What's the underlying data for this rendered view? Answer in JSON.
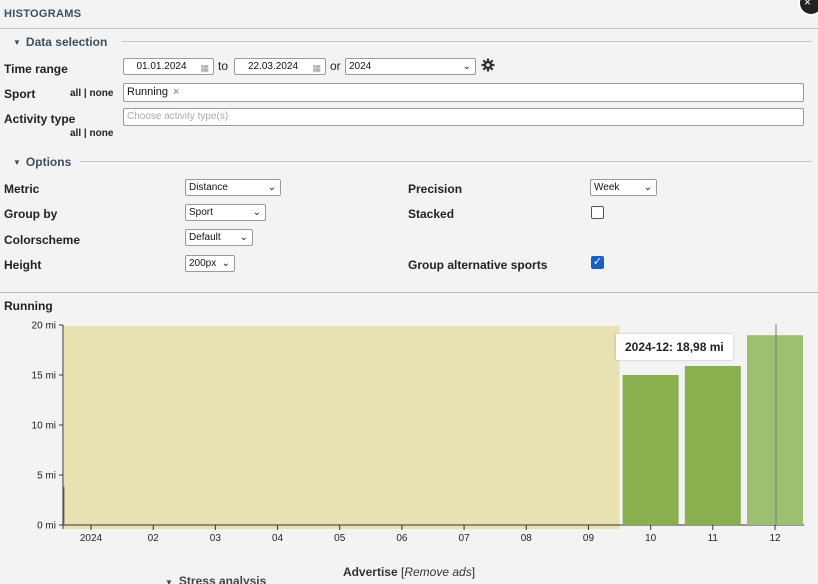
{
  "header": {
    "title": "HISTOGRAMS",
    "close_glyph": "×"
  },
  "data_selection": {
    "heading": "Data selection",
    "time_range": {
      "label": "Time range",
      "from": "01.01.2024",
      "to_word": "to",
      "to": "22.03.2024",
      "or_word": "or",
      "year": "2024"
    },
    "sport": {
      "label": "Sport",
      "all": "all",
      "sep": "|",
      "none": "none",
      "chip": "Running",
      "chip_remove": "×"
    },
    "activity_type": {
      "label": "Activity type",
      "placeholder": "Choose activity type(s)",
      "all": "all",
      "sep": "|",
      "none": "none"
    }
  },
  "options": {
    "heading": "Options",
    "metric": {
      "label": "Metric",
      "value": "Distance"
    },
    "group_by": {
      "label": "Group by",
      "value": "Sport"
    },
    "colorscheme": {
      "label": "Colorscheme",
      "value": "Default"
    },
    "height": {
      "label": "Height",
      "value": "200px"
    },
    "precision": {
      "label": "Precision",
      "value": "Week"
    },
    "stacked": {
      "label": "Stacked",
      "checked": false
    },
    "group_alt": {
      "label": "Group alternative sports",
      "checked": true
    }
  },
  "chart_data": {
    "type": "bar",
    "title": "Running",
    "xlabel": "",
    "ylabel": "",
    "ylim": [
      0,
      20
    ],
    "yticks": [
      "0 mi",
      "5 mi",
      "10 mi",
      "15 mi",
      "20 mi"
    ],
    "categories": [
      "2024",
      "02",
      "03",
      "04",
      "05",
      "06",
      "07",
      "08",
      "09",
      "10",
      "11",
      "12"
    ],
    "values": [
      0,
      0,
      0,
      0,
      0,
      0,
      0,
      0,
      0,
      15.0,
      15.9,
      18.98
    ],
    "highlight_range": [
      "2024",
      "09"
    ],
    "tooltip": "2024-12: 18,98 mi",
    "grid": false,
    "colors": {
      "bar": "#88b04e",
      "bar_hover": "#9dc070",
      "highlight": "#e8e1b2"
    }
  },
  "footer": {
    "advertise": "Advertise",
    "remove_ads": "Remove ads",
    "open": "[",
    "close": "]",
    "partial": "Stress analysis"
  }
}
